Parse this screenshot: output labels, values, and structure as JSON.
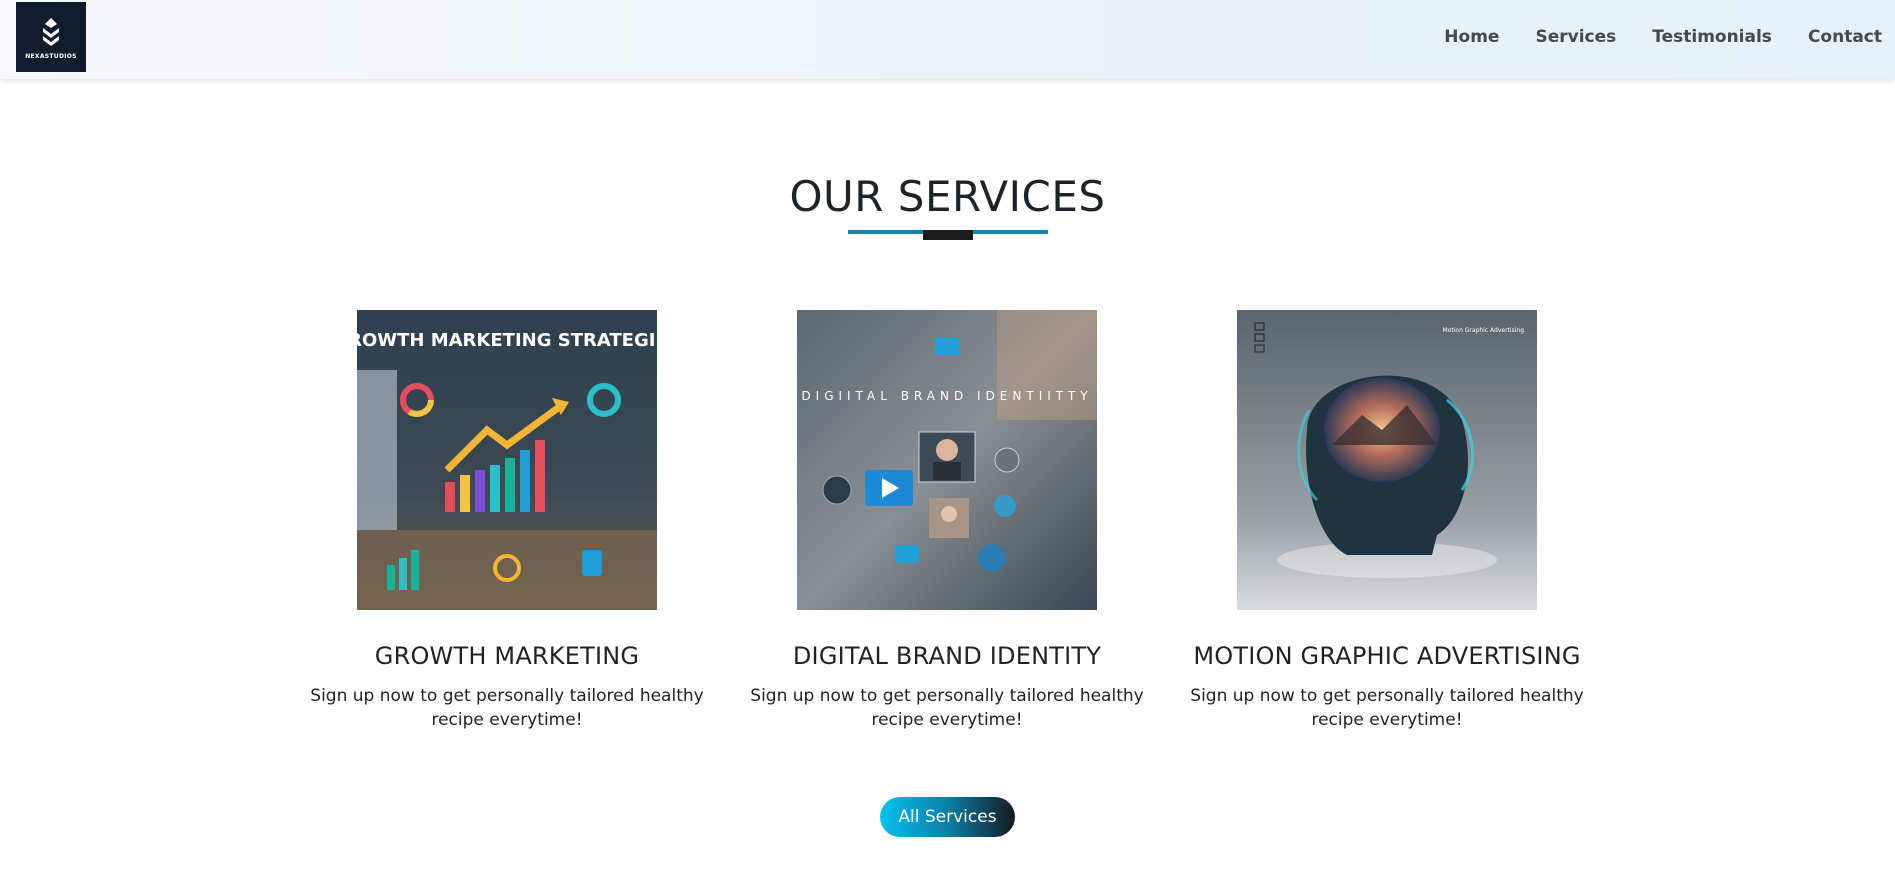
{
  "header": {
    "logo_text": "NEXASTUDIOS",
    "nav": [
      "Home",
      "Services",
      "Testimonials",
      "Contact"
    ]
  },
  "section": {
    "title": "OUR SERVICES"
  },
  "services": [
    {
      "title": "GROWTH MARKETING",
      "description": "Sign up now to get personally tailored healthy recipe everytime!",
      "image_caption": "GROWTH MARKETING STRATEGIES"
    },
    {
      "title": "DIGITAL BRAND IDENTITY",
      "description": "Sign up now to get personally tailored healthy recipe everytime!",
      "image_caption": "DIGIITAL BRAND IDENTIITTY"
    },
    {
      "title": "MOTION GRAPHIC ADVERTISING",
      "description": "Sign up now to get personally tailored healthy recipe everytime!",
      "image_caption": "Motion Graphic Advertising"
    }
  ],
  "cta": {
    "label": "All Services"
  },
  "colors": {
    "accent": "#1685a8",
    "button_start": "#05c3ef",
    "button_end": "#151a1f",
    "logo_bg": "#121a2e"
  }
}
